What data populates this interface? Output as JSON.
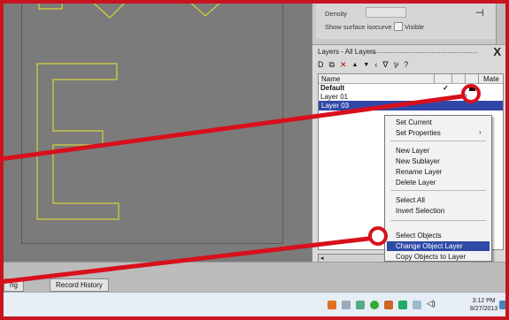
{
  "properties": {
    "density_label": "Density",
    "show_surface_label": "Show surface isocurve",
    "visible_label": "Visible"
  },
  "layers_panel": {
    "title": "Layers - All Layers",
    "close_glyph": "X",
    "toolbar_icons": [
      "new-layer-icon",
      "copy-icon",
      "delete-icon",
      "move-up-icon",
      "move-down-icon",
      "back-icon",
      "filter-icon",
      "tools-icon",
      "help-icon"
    ],
    "toolbar_glyphs": [
      "D",
      "⧉",
      "✕",
      "▲",
      "▼",
      "‹",
      "∇",
      "⅌",
      "?"
    ],
    "columns": {
      "name": "Name",
      "material": "Mate"
    },
    "rows": [
      {
        "name": "Default",
        "check": "✓",
        "bold": true
      },
      {
        "name": "Layer 01",
        "check": "",
        "bold": false
      },
      {
        "name": "Layer 03",
        "check": "",
        "bold": false
      }
    ]
  },
  "context_menu": {
    "items": [
      {
        "label": "Set Current"
      },
      {
        "label": "Set Properties",
        "submenu": "›"
      },
      {
        "label": "New Layer"
      },
      {
        "label": "New Sublayer"
      },
      {
        "label": "Rename Layer"
      },
      {
        "label": "Delete Layer"
      },
      {
        "label": "Select All"
      },
      {
        "label": "Invert Selection"
      },
      {
        "label": "Select Objects"
      },
      {
        "label": "Change Object Layer"
      },
      {
        "label": "Copy Objects to Layer"
      }
    ]
  },
  "bottom_tabs": [
    "ng",
    "Record History"
  ],
  "clock": {
    "time": "3:12 PM",
    "date": "8/27/2013"
  },
  "colors": {
    "annotation_red": "#d8101c",
    "selection_blue": "#2f4aa6",
    "curve_yellow": "#d4d23a"
  }
}
